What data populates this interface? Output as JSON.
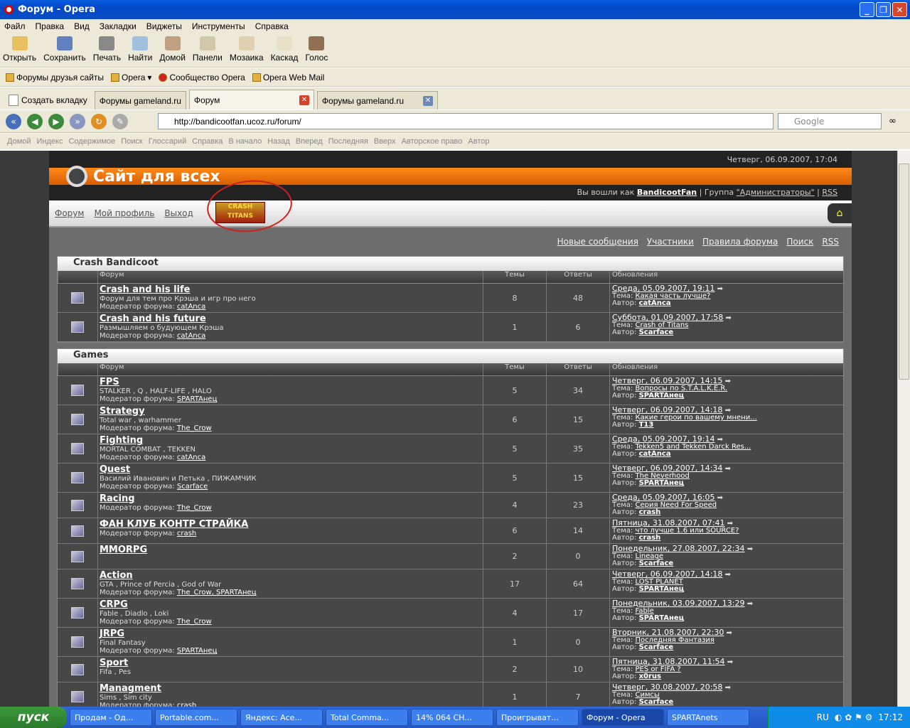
{
  "window": {
    "title": "Форум - Opera"
  },
  "menu": [
    "Файл",
    "Правка",
    "Вид",
    "Закладки",
    "Виджеты",
    "Инструменты",
    "Справка"
  ],
  "toolbar": [
    "Открыть",
    "Сохранить",
    "Печать",
    "Найти",
    "Домой",
    "Панели",
    "Мозаика",
    "Каскад",
    "Голос"
  ],
  "bookmarks": [
    "Форумы друзья сайты",
    "Opera",
    "Сообщество Opera",
    "Opera Web Mail"
  ],
  "tabs": [
    "Создать вкладку",
    "Форумы gameland.ru",
    "Форум",
    "Форумы gameland.ru"
  ],
  "address": {
    "url": "http://bandicootfan.ucoz.ru/forum/",
    "search_placeholder": "Google"
  },
  "navlinks": [
    "Домой",
    "Индекс",
    "Содержимое",
    "Поиск",
    "Глоссарий",
    "Справка",
    "В начало",
    "Назад",
    "Вперед",
    "Последняя",
    "Вверх",
    "Авторское право",
    "Автор"
  ],
  "site": {
    "date": "Четверг, 06.09.2007, 17:04",
    "title": "Сайт для всех",
    "logged_prefix": "Вы вошли как",
    "user": "BandicootFan",
    "group_prefix": "| Группа",
    "group": "\"Администраторы\"",
    "rss": "RSS",
    "nav": [
      "Форум",
      "Мой профиль",
      "Выход"
    ],
    "logo_text": "CRASH TITANS",
    "links": [
      "Новые сообщения",
      "Участники",
      "Правила форума",
      "Поиск",
      "RSS"
    ]
  },
  "cols": {
    "forum": "Форум",
    "topics": "Темы",
    "replies": "Ответы",
    "updates": "Обновления"
  },
  "categories": [
    {
      "name": "Crash Bandicoot",
      "forums": [
        {
          "name": "Crash and his life",
          "desc": "Форум для тем про Крэша и игр про него",
          "mod_label": "Модератор форума:",
          "mod": "catAnca",
          "topics": "8",
          "replies": "48",
          "date": "Среда, 05.09.2007, 19:11",
          "topic_label": "Тема:",
          "topic": "Какая часть лучше?",
          "author_label": "Автор:",
          "author": "catAnca"
        },
        {
          "name": "Crash and his future",
          "desc": "Размышляем о будующем Крэша",
          "mod_label": "Модератор форума:",
          "mod": "catAnca",
          "topics": "1",
          "replies": "6",
          "date": "Суббота, 01.09.2007, 17:58",
          "topic_label": "Тема:",
          "topic": "Crash of Titans",
          "author_label": "Автор:",
          "author": "Scarface"
        }
      ]
    },
    {
      "name": "Games",
      "forums": [
        {
          "name": "FPS",
          "desc": "STALKER , Q , HALF-LIFE , HALO",
          "mod_label": "Модератор форума:",
          "mod": "SPARTAнец",
          "topics": "5",
          "replies": "34",
          "date": "Четверг, 06.09.2007, 14:15",
          "topic_label": "Тема:",
          "topic": "Вопросы по S.T.A.L.K.E.R.",
          "author_label": "Автор:",
          "author": "SPARTAнец"
        },
        {
          "name": "Strategy",
          "desc": "Total war , warhammer",
          "mod_label": "Модератор форума:",
          "mod": "The_Crow",
          "topics": "6",
          "replies": "15",
          "date": "Четверг, 06.09.2007, 14:18",
          "topic_label": "Тема:",
          "topic": "Какие герои по вашему мнени...",
          "author_label": "Автор:",
          "author": "T13"
        },
        {
          "name": "Fighting",
          "desc": "MORTAL COMBAT , TEKKEN",
          "mod_label": "Модератор форума:",
          "mod": "catAnca",
          "topics": "5",
          "replies": "35",
          "date": "Среда, 05.09.2007, 19:14",
          "topic_label": "Тема:",
          "topic": "Tekken5 and Tekken Darck Res...",
          "author_label": "Автор:",
          "author": "catAnca"
        },
        {
          "name": "Quest",
          "desc": "Василий Иванович и Петька , ПИЖАМЧИК",
          "mod_label": "Модератор форума:",
          "mod": "Scarface",
          "topics": "5",
          "replies": "15",
          "date": "Четверг, 06.09.2007, 14:34",
          "topic_label": "Тема:",
          "topic": "The Neverhood",
          "author_label": "Автор:",
          "author": "SPARTAнец"
        },
        {
          "name": "Racing",
          "desc": "",
          "mod_label": "Модератор форума:",
          "mod": "The_Crow",
          "topics": "4",
          "replies": "23",
          "date": "Среда, 05.09.2007, 16:05",
          "topic_label": "Тема:",
          "topic": "Серия Need For Speed",
          "author_label": "Автор:",
          "author": "crash"
        },
        {
          "name": "ФАН КЛУБ КОНТР СТРАЙКА",
          "desc": "",
          "mod_label": "Модератор форума:",
          "mod": "crash",
          "topics": "6",
          "replies": "14",
          "date": "Пятница, 31.08.2007, 07:41",
          "topic_label": "Тема:",
          "topic": "что лучше 1.6 или SOURCE?",
          "author_label": "Автор:",
          "author": "crash"
        },
        {
          "name": "MMORPG",
          "desc": "",
          "mod_label": "",
          "mod": "",
          "topics": "2",
          "replies": "0",
          "date": "Понедельник, 27.08.2007, 22:34",
          "topic_label": "Тема:",
          "topic": "Lineage",
          "author_label": "Автор:",
          "author": "Scarface"
        },
        {
          "name": "Action",
          "desc": "GTA , Prince of Percia , God of War",
          "mod_label": "Модератор форума:",
          "mod": "The_Crow, SPARTAнец",
          "topics": "17",
          "replies": "64",
          "date": "Четверг, 06.09.2007, 14:18",
          "topic_label": "Тема:",
          "topic": "LOST PLANET",
          "author_label": "Автор:",
          "author": "SPARTAнец"
        },
        {
          "name": "CRPG",
          "desc": "Fable , Diadlo , Loki",
          "mod_label": "Модератор форума:",
          "mod": "The_Crow",
          "topics": "4",
          "replies": "17",
          "date": "Понедельник, 03.09.2007, 13:29",
          "topic_label": "Тема:",
          "topic": "Fable",
          "author_label": "Автор:",
          "author": "SPARTAнец"
        },
        {
          "name": "JRPG",
          "desc": "Final Fantasy",
          "mod_label": "Модератор форума:",
          "mod": "SPARTAнец",
          "topics": "1",
          "replies": "0",
          "date": "Вторник, 21.08.2007, 22:30",
          "topic_label": "Тема:",
          "topic": "Последняя Фантазия",
          "author_label": "Автор:",
          "author": "Scarface"
        },
        {
          "name": "Sport",
          "desc": "Fifa , Pes",
          "mod_label": "",
          "mod": "",
          "topics": "2",
          "replies": "10",
          "date": "Пятница, 31.08.2007, 11:54",
          "topic_label": "Тема:",
          "topic": "PES or FIFA ?",
          "author_label": "Автор:",
          "author": "x0rus"
        },
        {
          "name": "Managment",
          "desc": "Sims , Sim city",
          "mod_label": "Модератор форума:",
          "mod": "crash",
          "topics": "1",
          "replies": "7",
          "date": "Четверг, 30.08.2007, 20:58",
          "topic_label": "Тема:",
          "topic": "Симсы",
          "author_label": "Автор:",
          "author": "Scarface"
        }
      ]
    }
  ],
  "taskbar": {
    "start": "пуск",
    "items": [
      "Продам - Од...",
      "Portable.com...",
      "Яндекс: Асе...",
      "Total Comma...",
      "14% 064 СН...",
      "Проигрыват...",
      "Форум - Opera",
      "SPARTAnets"
    ],
    "lang": "RU",
    "time": "17:12"
  }
}
